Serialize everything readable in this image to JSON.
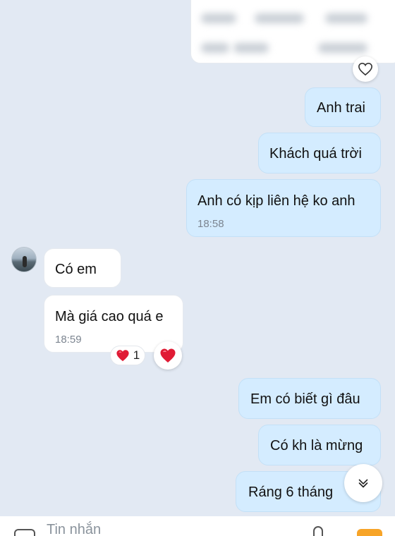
{
  "colors": {
    "background": "#e2e9f3",
    "outgoing_bubble": "#d4ecff",
    "incoming_bubble": "#ffffff",
    "heart": "#e01b35",
    "attach_button": "#f7a428"
  },
  "messages": {
    "m1": {
      "text": "Anh trai"
    },
    "m2": {
      "text": "Khách quá trời"
    },
    "m3": {
      "text": "Anh có kịp liên hệ ko anh",
      "time": "18:58"
    },
    "m4": {
      "text": "Có em"
    },
    "m5": {
      "text": "Mà giá cao quá e",
      "time": "18:59"
    },
    "m6": {
      "text": "Em có biết gì đâu"
    },
    "m7": {
      "text": "Có kh là mừng"
    },
    "m8": {
      "text": "Ráng 6 tháng"
    }
  },
  "reaction": {
    "icon": "heart-icon",
    "count": "1"
  },
  "icons": {
    "card_like": "heart-outline-icon",
    "react_button": "heart-icon",
    "scroll_down": "chevron-down-icon",
    "sticker": "sticker-icon"
  },
  "composer": {
    "placeholder": "Tin nhắn"
  }
}
